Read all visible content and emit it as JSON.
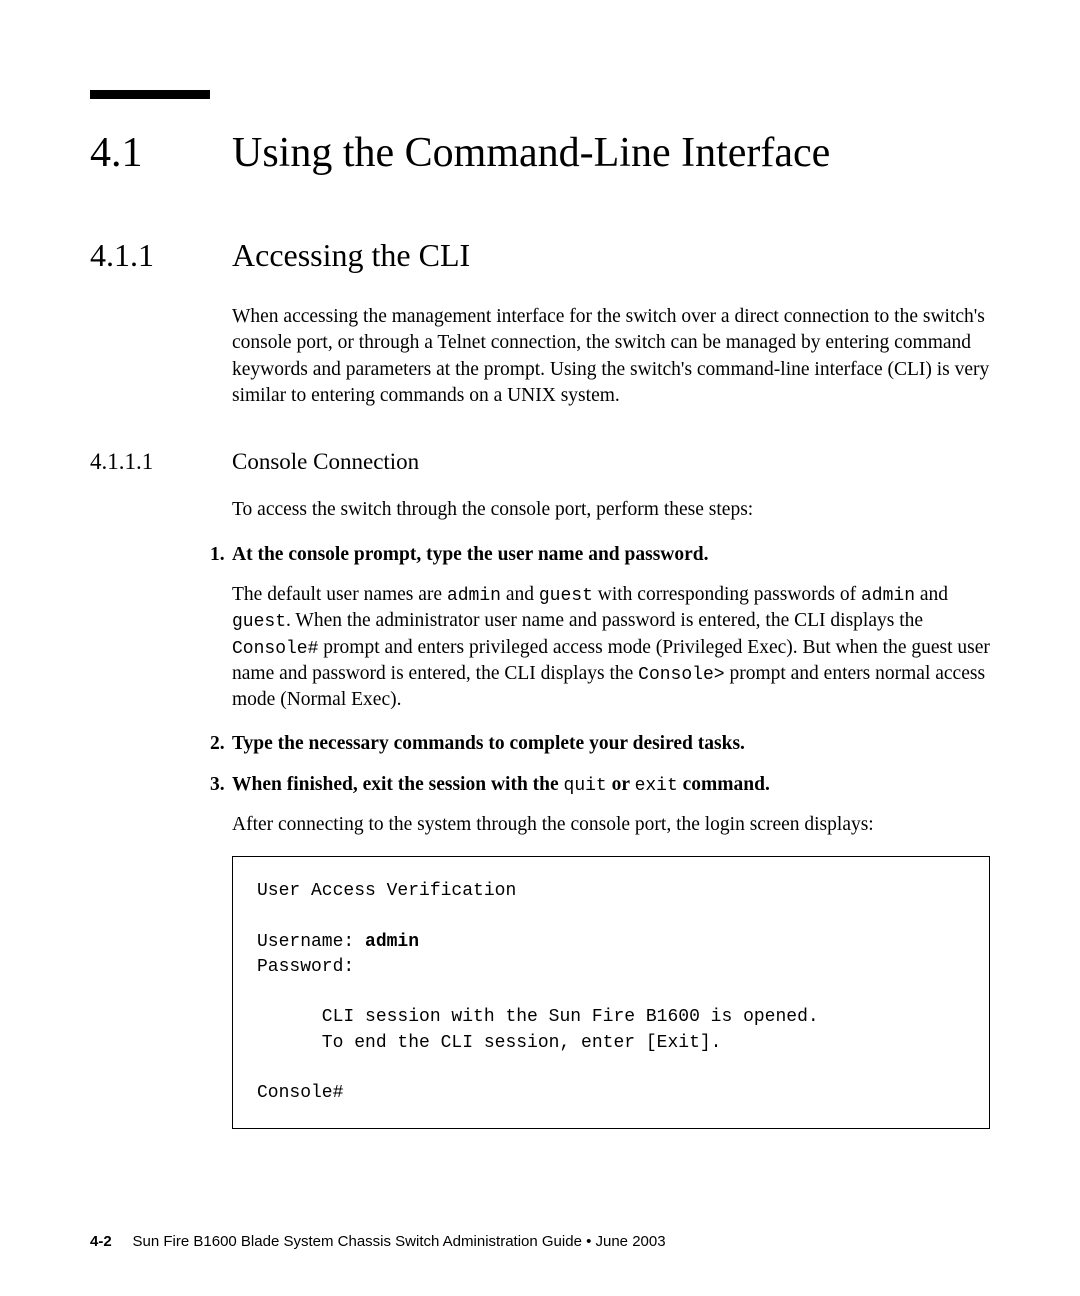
{
  "section": {
    "number": "4.1",
    "title": "Using the Command-Line Interface"
  },
  "subsection": {
    "number": "4.1.1",
    "title": "Accessing the CLI",
    "body": "When accessing the management interface for the switch over a direct connection to the switch's console port, or through a Telnet connection, the switch can be managed by entering command keywords and parameters at the prompt. Using the switch's command-line interface (CLI) is very similar to entering commands on a UNIX system."
  },
  "subsubsection": {
    "number": "4.1.1.1",
    "title": "Console Connection",
    "intro": "To access the switch through the console port, perform these steps:",
    "steps": [
      {
        "num": "1.",
        "heading": "At the console prompt, type the user name and password.",
        "body_parts": {
          "p1": "The default user names are ",
          "c1": "admin",
          "p2": " and ",
          "c2": "guest",
          "p3": " with corresponding passwords of ",
          "c3": "admin",
          "p4": " and ",
          "c4": "guest",
          "p5": ". When the administrator user name and password is entered, the CLI displays the ",
          "c5": "Console#",
          "p6": " prompt and enters privileged access mode (Privileged Exec). But when the guest user name and password is entered, the CLI displays the ",
          "c6": "Console>",
          "p7": " prompt and enters normal access mode (Normal Exec)."
        }
      },
      {
        "num": "2.",
        "heading": "Type the necessary commands to complete your desired tasks."
      },
      {
        "num": "3.",
        "heading_parts": {
          "b1": "When finished, exit the session with the ",
          "c1": "quit",
          "b2": " or ",
          "c2": "exit",
          "b3": " command."
        }
      }
    ],
    "after": "After connecting to the system through the console port, the login screen displays:",
    "code": {
      "l1": "User Access Verification",
      "l2": "",
      "l3a": "Username: ",
      "l3b": "admin",
      "l4": "Password:",
      "l5": "",
      "l6": "      CLI session with the Sun Fire B1600 is opened.",
      "l7": "      To end the CLI session, enter [Exit].",
      "l8": "",
      "l9": "Console#"
    }
  },
  "footer": {
    "pagenum": "4-2",
    "text": "Sun Fire B1600 Blade System Chassis Switch Administration Guide • June 2003"
  }
}
